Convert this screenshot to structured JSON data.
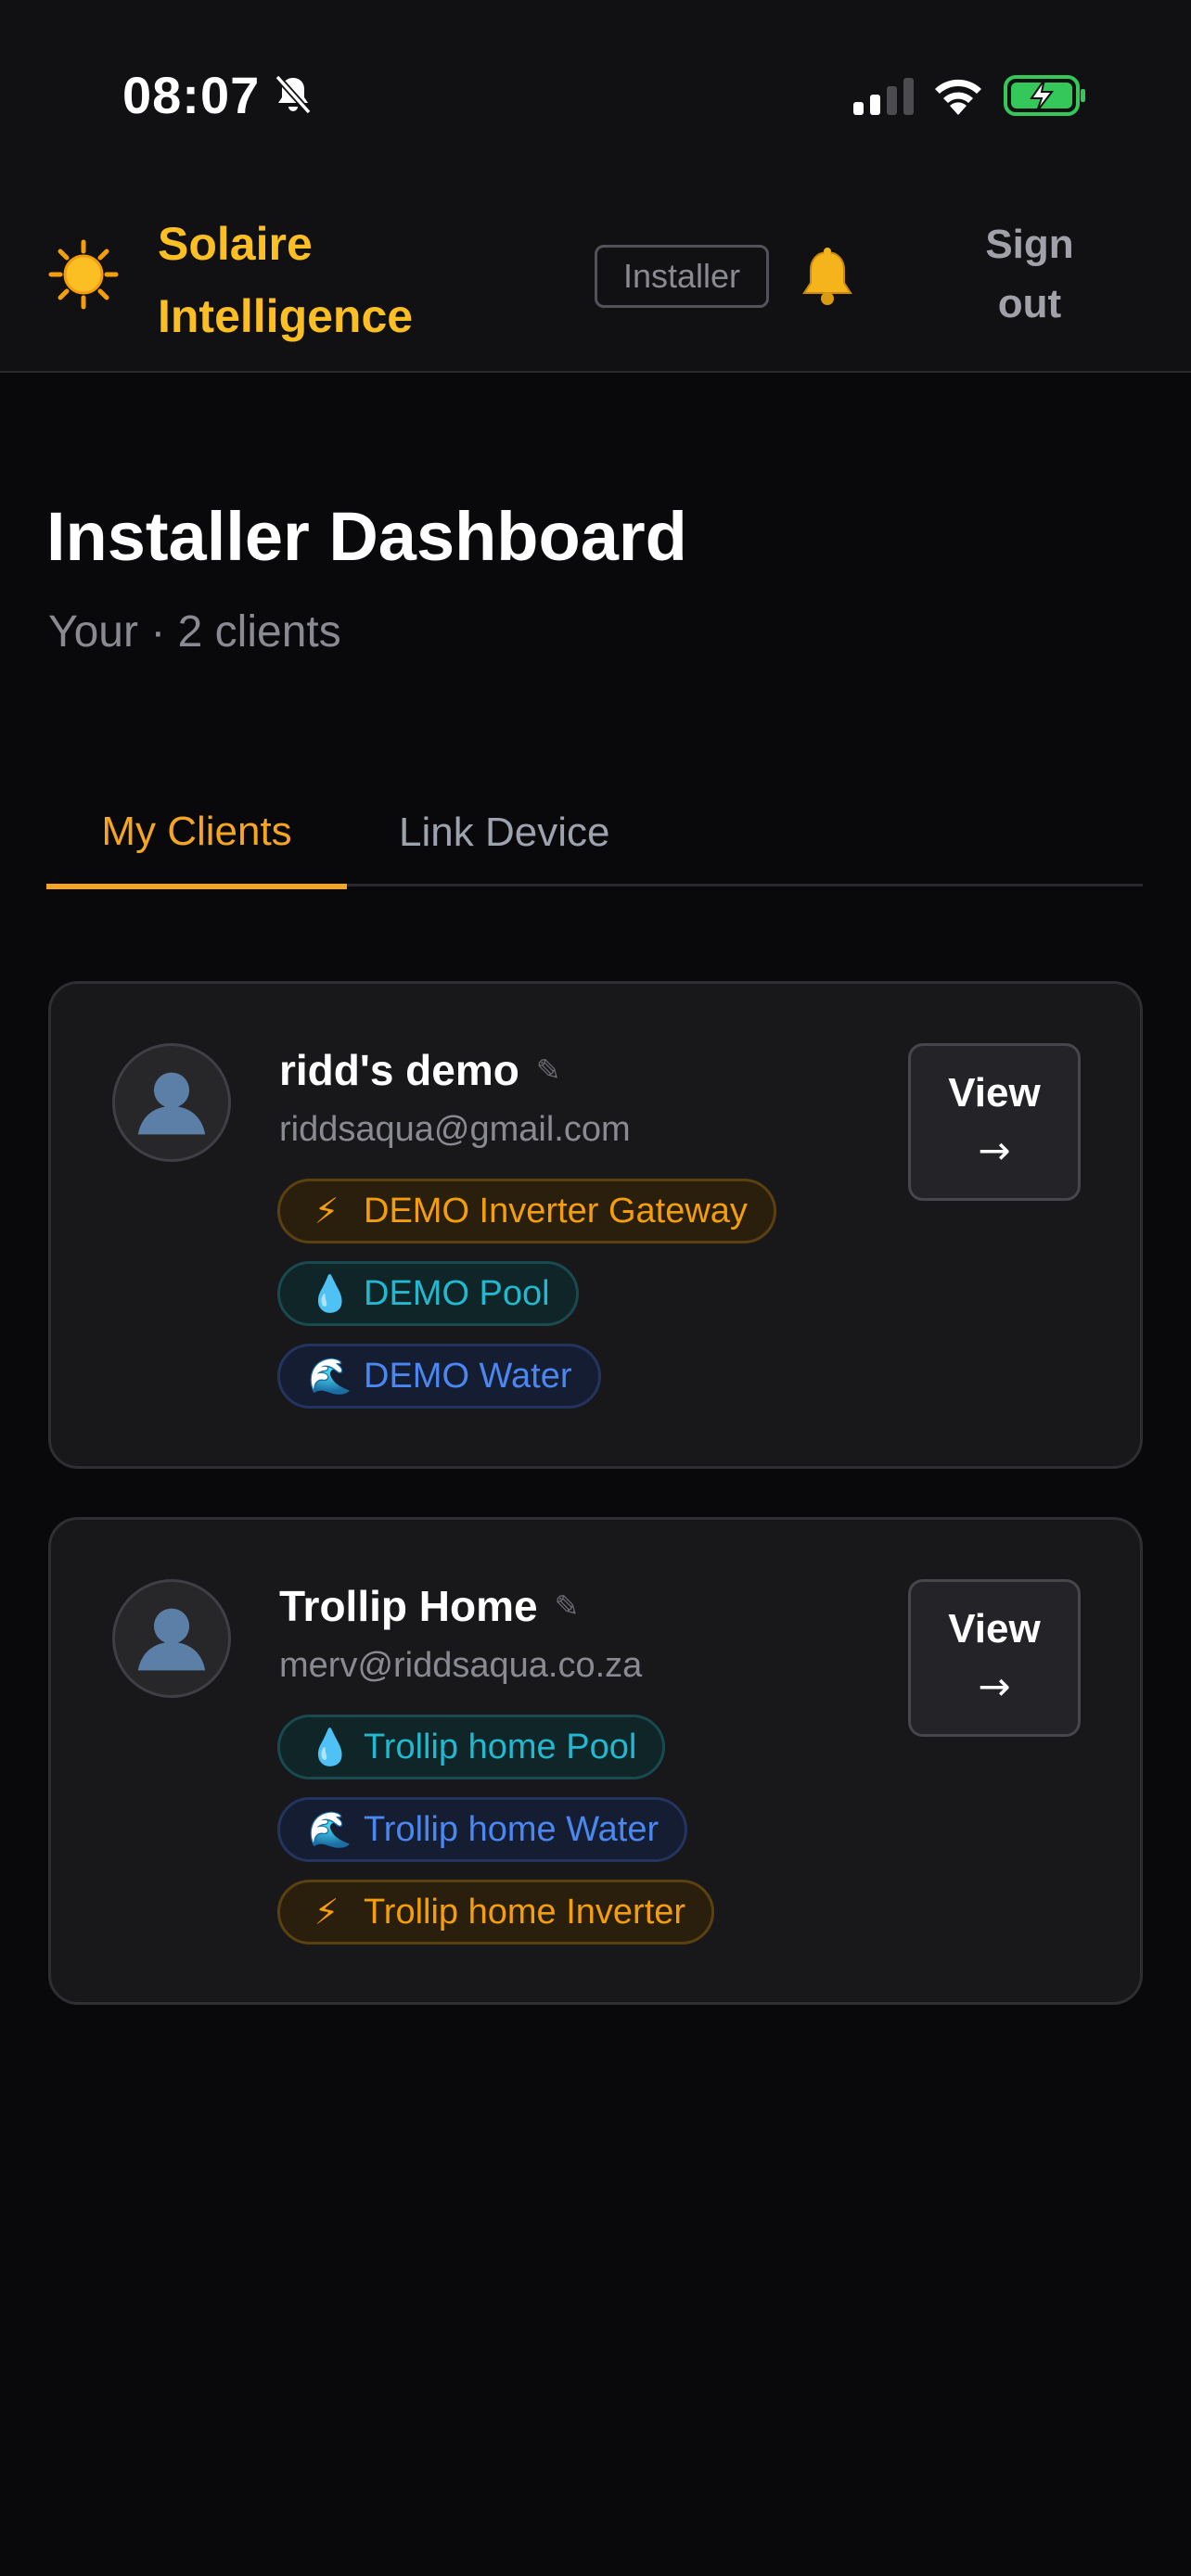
{
  "status_bar": {
    "time": "08:07"
  },
  "header": {
    "brand_line1": "Solaire",
    "brand_line2": "Intelligence",
    "role_badge": "Installer",
    "sign_out_line1": "Sign",
    "sign_out_line2": "out",
    "icons": {
      "logo": "sun-icon",
      "notifications": "bell-icon"
    }
  },
  "page": {
    "title": "Installer Dashboard",
    "subtitle": "Your · 2 clients"
  },
  "tabs": [
    {
      "label": "My Clients",
      "active": true
    },
    {
      "label": "Link Device",
      "active": false
    }
  ],
  "clients": [
    {
      "name": "ridd's demo",
      "email": "riddsaqua@gmail.com",
      "view_label": "View",
      "view_arrow": "→",
      "devices": [
        {
          "label": "DEMO Inverter Gateway",
          "kind": "inverter",
          "icon": "⚡"
        },
        {
          "label": "DEMO Pool",
          "kind": "pool",
          "icon": "💧"
        },
        {
          "label": "DEMO Water",
          "kind": "water",
          "icon": "🌊"
        }
      ]
    },
    {
      "name": "Trollip Home",
      "email": "merv@riddsaqua.co.za",
      "view_label": "View",
      "view_arrow": "→",
      "devices": [
        {
          "label": "Trollip home Pool",
          "kind": "pool",
          "icon": "💧"
        },
        {
          "label": "Trollip home Water",
          "kind": "water",
          "icon": "🌊"
        },
        {
          "label": "Trollip home Inverter",
          "kind": "inverter",
          "icon": "⚡"
        }
      ]
    }
  ],
  "colors": {
    "accent": "#f5a524",
    "brand": "#fbbf24",
    "inverter": "#f59e0b",
    "pool": "#22b8cf",
    "water": "#4b87f0",
    "background": "#09090b",
    "card": "#18181b"
  }
}
